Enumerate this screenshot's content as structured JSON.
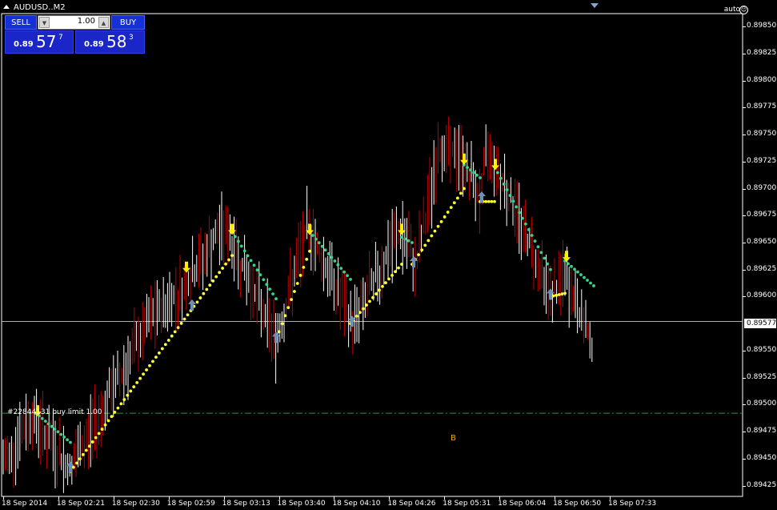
{
  "window": {
    "title": "AUDUSD..M2",
    "auto_label": "auto"
  },
  "trade_panel": {
    "sell_label": "SELL",
    "buy_label": "BUY",
    "lot": "1.00",
    "sell_price": {
      "small": "0.89",
      "big": "57",
      "sup": "7"
    },
    "buy_price": {
      "small": "0.89",
      "big": "58",
      "sup": "3"
    }
  },
  "price_axis": {
    "ticks": [
      "0.89850",
      "0.89825",
      "0.89800",
      "0.89775",
      "0.89750",
      "0.89725",
      "0.89700",
      "0.89675",
      "0.89650",
      "0.89625",
      "0.89600",
      "0.89577",
      "0.89550",
      "0.89525",
      "0.89500",
      "0.89475",
      "0.89450",
      "0.89425"
    ],
    "current_price": "0.89577"
  },
  "time_axis": {
    "labels": [
      "18 Sep 2014",
      "18 Sep 02:21",
      "18 Sep 02:30",
      "18 Sep 02:59",
      "18 Sep 03:13",
      "18 Sep 03:40",
      "18 Sep 04:10",
      "18 Sep 04:26",
      "18 Sep 05:31",
      "18 Sep 06:04",
      "18 Sep 06:50",
      "18 Sep 07:33"
    ]
  },
  "order": {
    "label": "#22844131 buy limit 1.00",
    "price": 0.89492
  },
  "b_marker": "B",
  "colors": {
    "background": "#000000",
    "bear_candle": "#c00000",
    "bull_candle": "#ffffff",
    "trend_up": "#ffff33",
    "trend_down": "#33d68a",
    "arrow_up": "#6f8fb8",
    "arrow_down": "#ffee00",
    "order_line": "#2e9c2e"
  },
  "chart_data": {
    "type": "candlestick",
    "symbol": "AUDUSD..",
    "timeframe": "M2",
    "ylim": [
      0.89415,
      0.89862
    ],
    "grid": false,
    "current_price": 0.89577,
    "pivots": [
      [
        0,
        0.8944
      ],
      [
        40,
        0.8949
      ],
      [
        88,
        0.8944
      ],
      [
        185,
        0.89575
      ],
      [
        230,
        0.8961
      ],
      [
        280,
        0.89665
      ],
      [
        345,
        0.8956
      ],
      [
        385,
        0.89665
      ],
      [
        440,
        0.89575
      ],
      [
        500,
        0.8966
      ],
      [
        520,
        0.8963
      ],
      [
        550,
        0.8974
      ],
      [
        580,
        0.89725
      ],
      [
        600,
        0.8969
      ],
      [
        610,
        0.8974
      ],
      [
        650,
        0.8967
      ],
      [
        690,
        0.896
      ],
      [
        705,
        0.8962
      ],
      [
        740,
        0.89555
      ]
    ],
    "trend_segments": [
      {
        "dir": "down",
        "x": [
          45,
          88
        ],
        "y": [
          0.89492,
          0.89465
        ]
      },
      {
        "dir": "up",
        "x": [
          88,
          290
        ],
        "y": [
          0.89438,
          0.89638
        ]
      },
      {
        "dir": "down",
        "x": [
          290,
          345
        ],
        "y": [
          0.8966,
          0.89598
        ]
      },
      {
        "dir": "up",
        "x": [
          345,
          387
        ],
        "y": [
          0.8956,
          0.89642
        ]
      },
      {
        "dir": "down",
        "x": [
          387,
          438
        ],
        "y": [
          0.8966,
          0.89616
        ]
      },
      {
        "dir": "up",
        "x": [
          438,
          502
        ],
        "y": [
          0.89575,
          0.8963
        ]
      },
      {
        "dir": "down",
        "x": [
          502,
          515
        ],
        "y": [
          0.89655,
          0.8965
        ]
      },
      {
        "dir": "up",
        "x": [
          515,
          580
        ],
        "y": [
          0.8963,
          0.897
        ]
      },
      {
        "dir": "down",
        "x": [
          580,
          600
        ],
        "y": [
          0.89722,
          0.8971
        ]
      },
      {
        "dir": "up",
        "x": [
          600,
          618
        ],
        "y": [
          0.89688,
          0.89688
        ]
      },
      {
        "dir": "down",
        "x": [
          618,
          688
        ],
        "y": [
          0.8972,
          0.89625
        ]
      },
      {
        "dir": "up",
        "x": [
          688,
          706
        ],
        "y": [
          0.896,
          0.89603
        ]
      },
      {
        "dir": "down",
        "x": [
          706,
          742
        ],
        "y": [
          0.89633,
          0.8961
        ]
      }
    ],
    "arrows": [
      {
        "dir": "up",
        "x": 88,
        "y": 0.8944
      },
      {
        "dir": "up",
        "x": 240,
        "y": 0.8959
      },
      {
        "dir": "up",
        "x": 345,
        "y": 0.8956
      },
      {
        "dir": "up",
        "x": 440,
        "y": 0.89575
      },
      {
        "dir": "up",
        "x": 517,
        "y": 0.8963
      },
      {
        "dir": "up",
        "x": 602,
        "y": 0.8969
      },
      {
        "dir": "up",
        "x": 688,
        "y": 0.896
      },
      {
        "dir": "down",
        "x": 47,
        "y": 0.89492
      },
      {
        "dir": "down",
        "x": 233,
        "y": 0.89625
      },
      {
        "dir": "down",
        "x": 290,
        "y": 0.8966
      },
      {
        "dir": "down",
        "x": 387,
        "y": 0.8966
      },
      {
        "dir": "down",
        "x": 502,
        "y": 0.8966
      },
      {
        "dir": "down",
        "x": 580,
        "y": 0.89725
      },
      {
        "dir": "down",
        "x": 619,
        "y": 0.8972
      },
      {
        "dir": "down",
        "x": 708,
        "y": 0.89635
      }
    ]
  }
}
